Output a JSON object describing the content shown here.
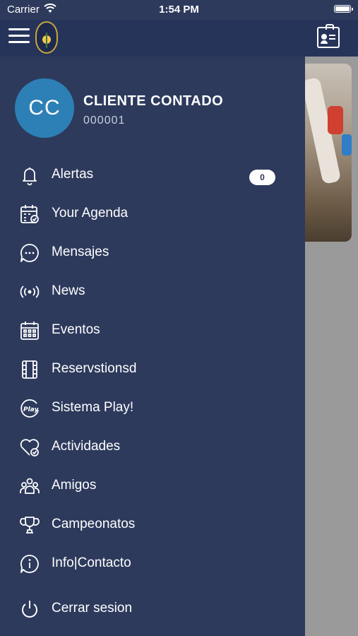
{
  "status_bar": {
    "carrier": "Carrier",
    "time": "1:54 PM"
  },
  "user": {
    "initials": "CC",
    "name": "CLIENTE CONTADO",
    "code": "000001"
  },
  "menu": [
    {
      "label": "Alertas",
      "icon": "bell-icon",
      "badge": "0"
    },
    {
      "label": "Your Agenda",
      "icon": "calendar-check-icon"
    },
    {
      "label": "Mensajes",
      "icon": "chat-bubble-icon"
    },
    {
      "label": "News",
      "icon": "broadcast-icon"
    },
    {
      "label": "Eventos",
      "icon": "calendar-grid-icon"
    },
    {
      "label": "Reservstionsd",
      "icon": "film-strip-icon"
    },
    {
      "label": "Sistema Play!",
      "icon": "play-logo-icon"
    },
    {
      "label": "Actividades",
      "icon": "heart-check-icon"
    },
    {
      "label": "Amigos",
      "icon": "group-icon"
    },
    {
      "label": "Campeonatos",
      "icon": "trophy-icon"
    },
    {
      "label": "Info|Contacto",
      "icon": "info-chat-icon"
    },
    {
      "label": "Cerrar sesion",
      "icon": "power-icon"
    }
  ]
}
